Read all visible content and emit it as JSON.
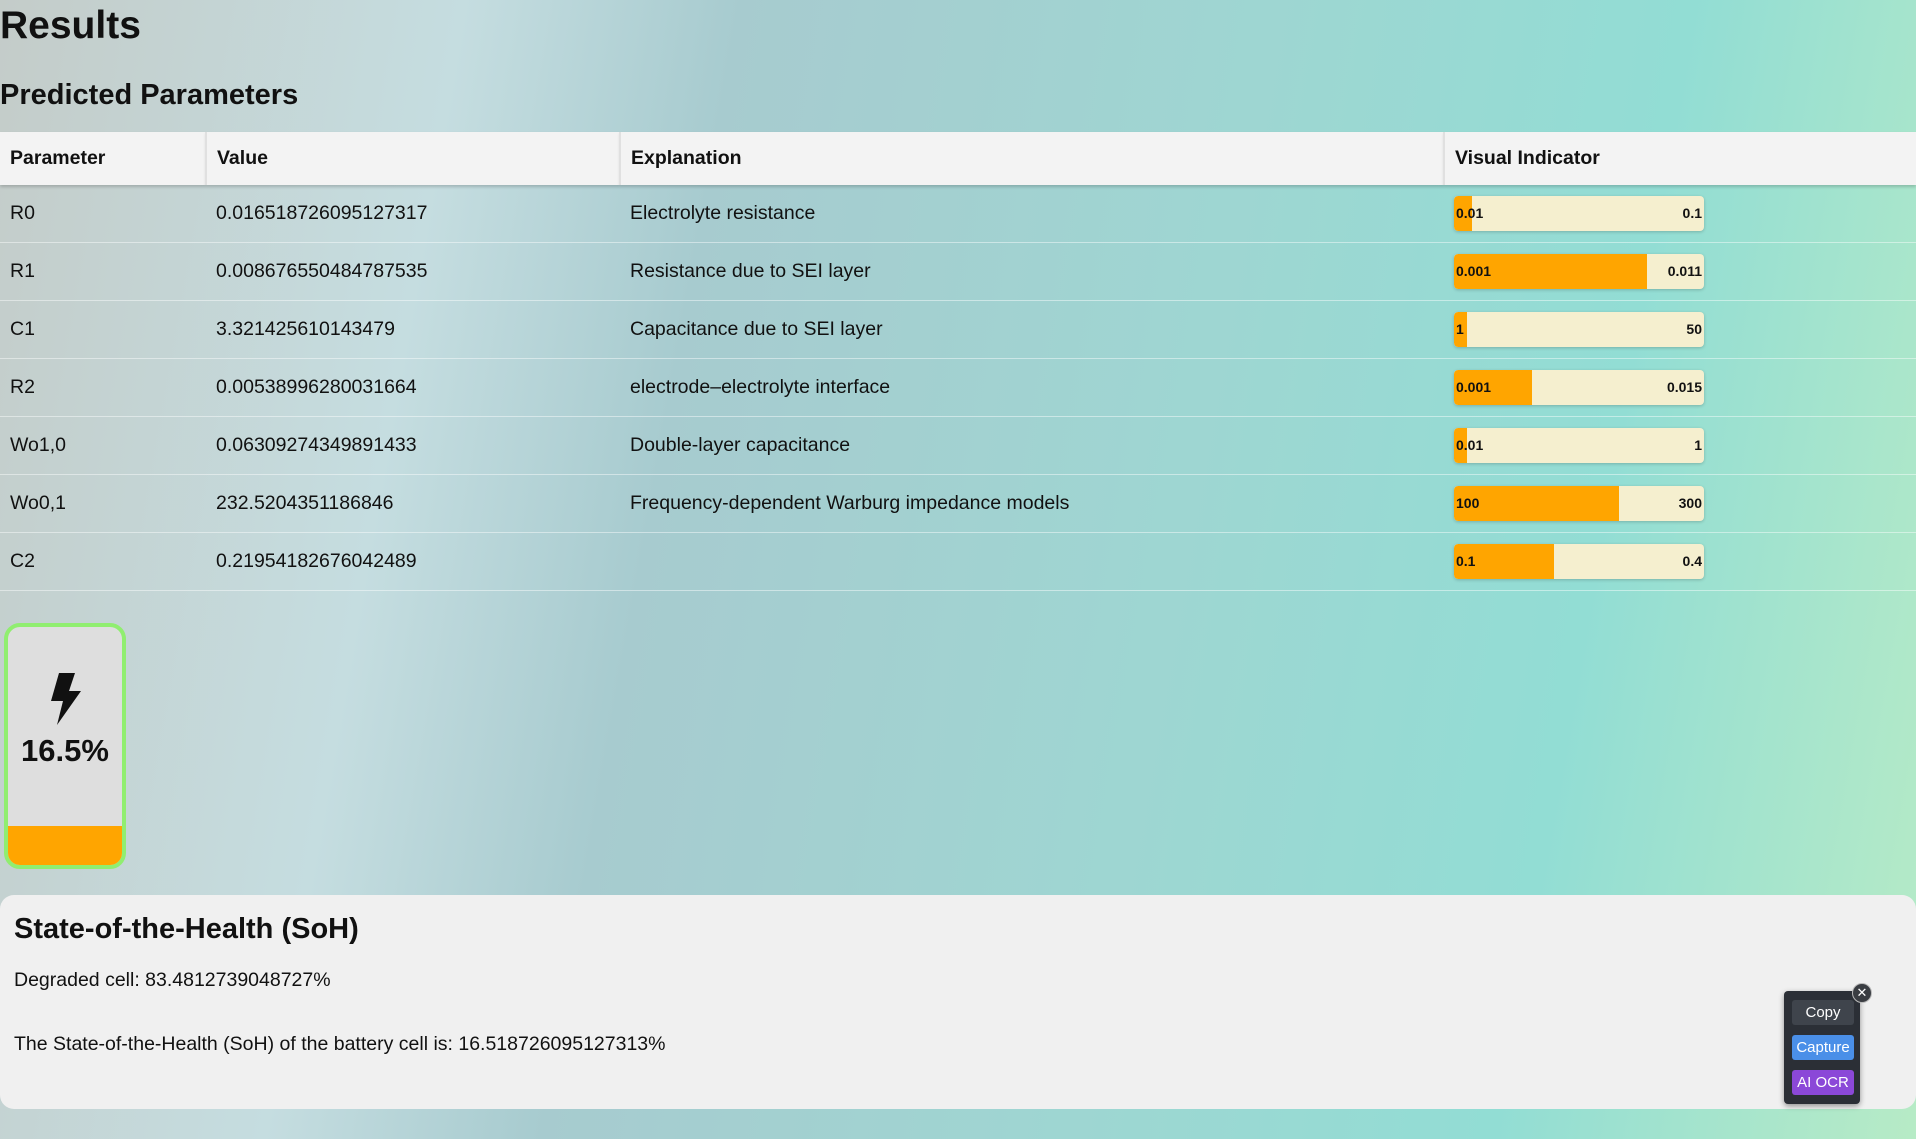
{
  "page": {
    "title": "Results",
    "subtitle": "Predicted Parameters"
  },
  "table": {
    "headers": [
      "Parameter",
      "Value",
      "Explanation",
      "Visual Indicator"
    ],
    "rows": [
      {
        "parameter": "R0",
        "value": "0.016518726095127317",
        "explanation": "Electrolyte resistance",
        "min_label": "0.01",
        "max_label": "0.1",
        "fill_fraction": 0.07
      },
      {
        "parameter": "R1",
        "value": "0.008676550484787535",
        "explanation": "Resistance due to SEI layer",
        "min_label": "0.001",
        "max_label": "0.011",
        "fill_fraction": 0.77
      },
      {
        "parameter": "C1",
        "value": "3.321425610143479",
        "explanation": "Capacitance due to SEI layer",
        "min_label": "1",
        "max_label": "50",
        "fill_fraction": 0.05
      },
      {
        "parameter": "R2",
        "value": "0.00538996280031664",
        "explanation": "electrode–electrolyte interface",
        "min_label": "0.001",
        "max_label": "0.015",
        "fill_fraction": 0.31
      },
      {
        "parameter": "Wo1,0",
        "value": "0.06309274349891433",
        "explanation": "Double-layer capacitance",
        "min_label": "0.01",
        "max_label": "1",
        "fill_fraction": 0.05
      },
      {
        "parameter": "Wo0,1",
        "value": "232.5204351186846",
        "explanation": "Frequency-dependent Warburg impedance models",
        "min_label": "100",
        "max_label": "300",
        "fill_fraction": 0.66
      },
      {
        "parameter": "C2",
        "value": "0.21954182676042489",
        "explanation": "",
        "min_label": "0.1",
        "max_label": "0.4",
        "fill_fraction": 0.4
      }
    ]
  },
  "battery": {
    "percent_label": "16.5%",
    "level_fraction": 0.165,
    "icon": "lightning-bolt-icon",
    "border_color": "#90ee70",
    "fill_color": "#ffa500"
  },
  "soh": {
    "heading": "State-of-the-Health (SoH)",
    "degraded": "Degraded cell: 83.4812739048727%",
    "statement": "The State-of-the-Health (SoH) of the battery cell is: 16.518726095127313%"
  },
  "toolbar": {
    "close_label": "✕",
    "copy_label": "Copy",
    "capture_label": "Capture",
    "ocr_label": "AI OCR"
  },
  "colors": {
    "bar_fill": "#ffa500",
    "bar_track": "#f5efcf"
  }
}
